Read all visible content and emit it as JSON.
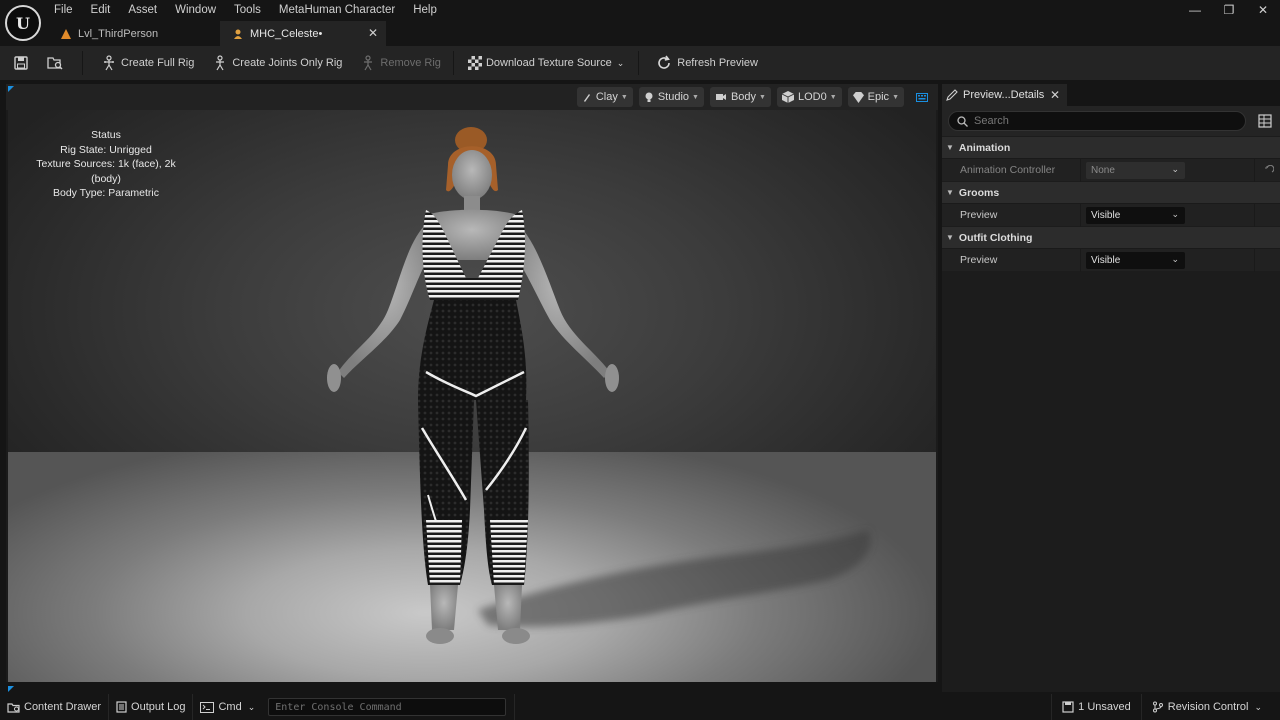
{
  "app": {
    "logo_text": "U"
  },
  "menu": [
    "File",
    "Edit",
    "Asset",
    "Window",
    "Tools",
    "MetaHuman Character",
    "Help"
  ],
  "tabs": [
    {
      "label": "Lvl_ThirdPerson",
      "active": false
    },
    {
      "label": "MHC_Celeste•",
      "active": true
    }
  ],
  "window_controls": {
    "minimize": "—",
    "restore": "❐",
    "close": "✕"
  },
  "toolbar": {
    "create_full_rig": "Create Full Rig",
    "create_joints_only_rig": "Create Joints Only Rig",
    "remove_rig": "Remove Rig",
    "download_texture_source": "Download Texture Source",
    "refresh_preview": "Refresh Preview"
  },
  "viewport": {
    "controls": {
      "clay": "Clay",
      "studio": "Studio",
      "body": "Body",
      "lod": "LOD0",
      "quality": "Epic"
    },
    "status": {
      "title": "Status",
      "rig_state": "Rig State: Unrigged",
      "texture_sources": "Texture Sources: 1k (face), 2k (body)",
      "body_type": "Body Type: Parametric"
    }
  },
  "details": {
    "tab_label": "Preview...Details",
    "search_placeholder": "Search",
    "categories": {
      "animation": {
        "label": "Animation",
        "controller_label": "Animation Controller",
        "controller_value": "None"
      },
      "grooms": {
        "label": "Grooms",
        "preview_label": "Preview",
        "preview_value": "Visible"
      },
      "outfit": {
        "label": "Outfit Clothing",
        "preview_label": "Preview",
        "preview_value": "Visible"
      }
    }
  },
  "statusbar": {
    "content_drawer": "Content Drawer",
    "output_log": "Output Log",
    "cmd": "Cmd",
    "console_placeholder": "Enter Console Command",
    "unsaved": "1 Unsaved",
    "revision_control": "Revision Control"
  },
  "colors": {
    "accent_blue": "#1a8fe0",
    "bg_dark": "#151515",
    "panel": "#242424"
  }
}
